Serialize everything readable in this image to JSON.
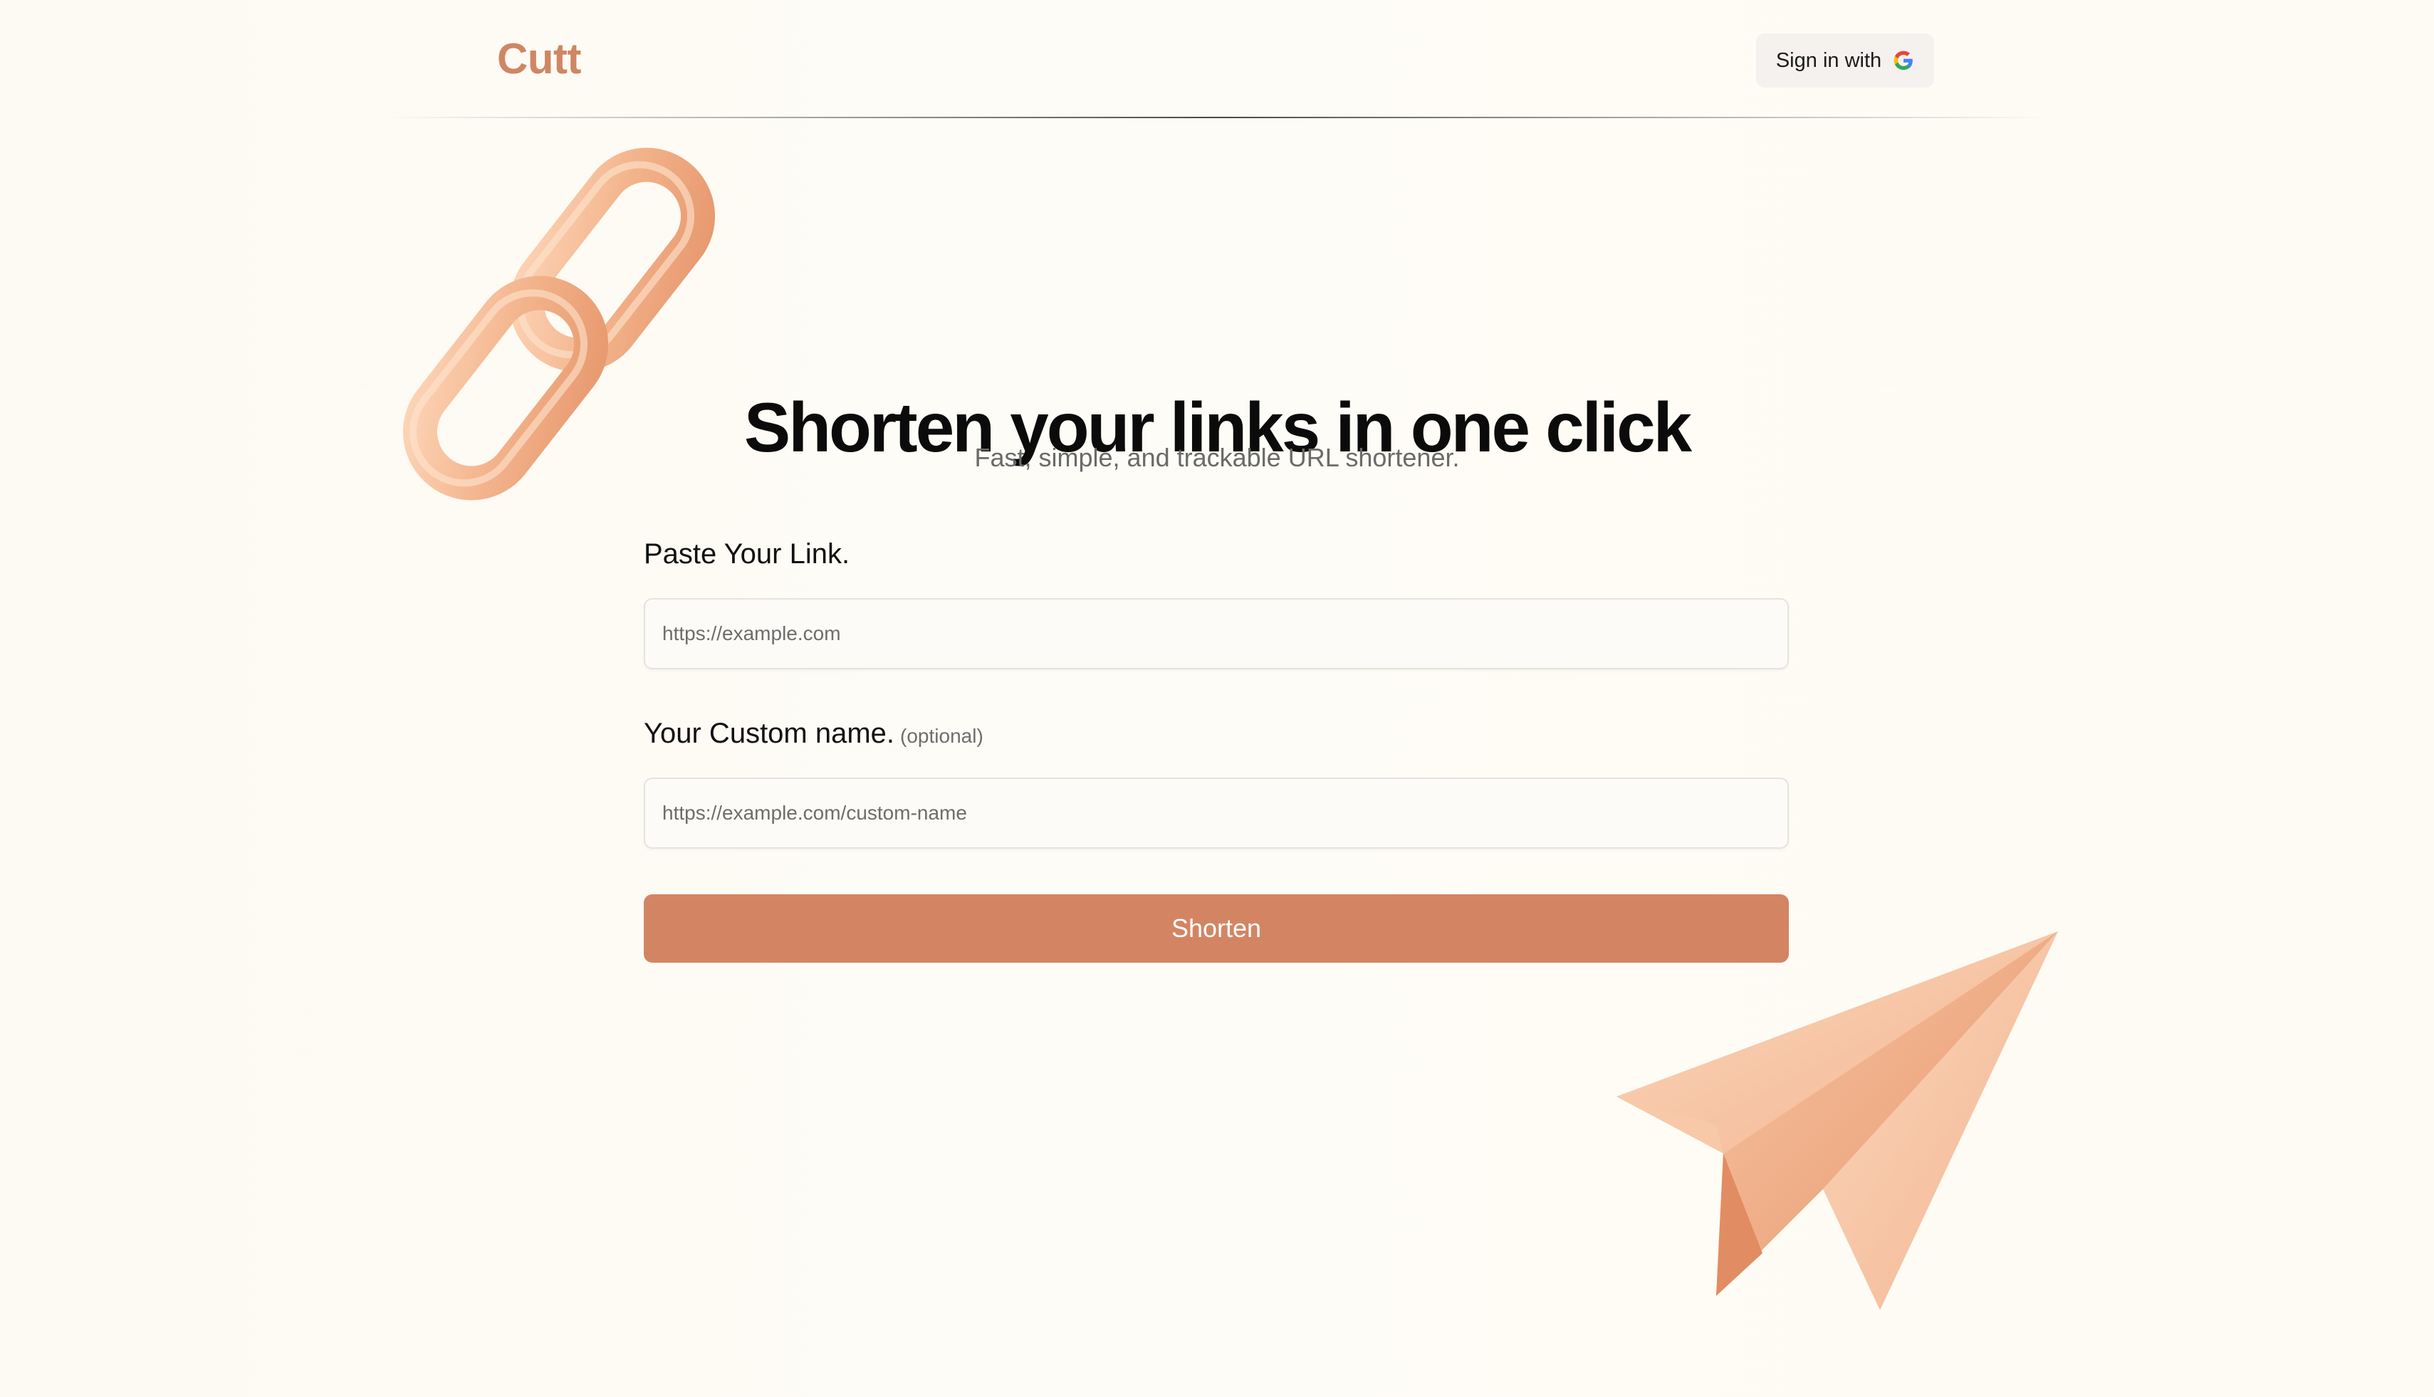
{
  "header": {
    "logo": "Cutt",
    "signin_label": "Sign in with",
    "signin_icon": "google-g-icon"
  },
  "hero": {
    "title": "Shorten your links in one click",
    "subtitle": "Fast, simple, and trackable URL shortener."
  },
  "form": {
    "link_label": "Paste Your Link.",
    "link_placeholder": "https://example.com",
    "link_value": "",
    "custom_label": "Your Custom name.",
    "custom_optional": "(optional)",
    "custom_placeholder": "https://example.com/custom-name",
    "custom_value": "",
    "submit_label": "Shorten"
  },
  "decorations": {
    "chain_icon": "chain-link-icon",
    "plane_icon": "paper-plane-icon"
  },
  "colors": {
    "accent": "#d38563",
    "logo": "#cf8663",
    "background": "#fdfaf4",
    "decor": "#f3b48c"
  }
}
